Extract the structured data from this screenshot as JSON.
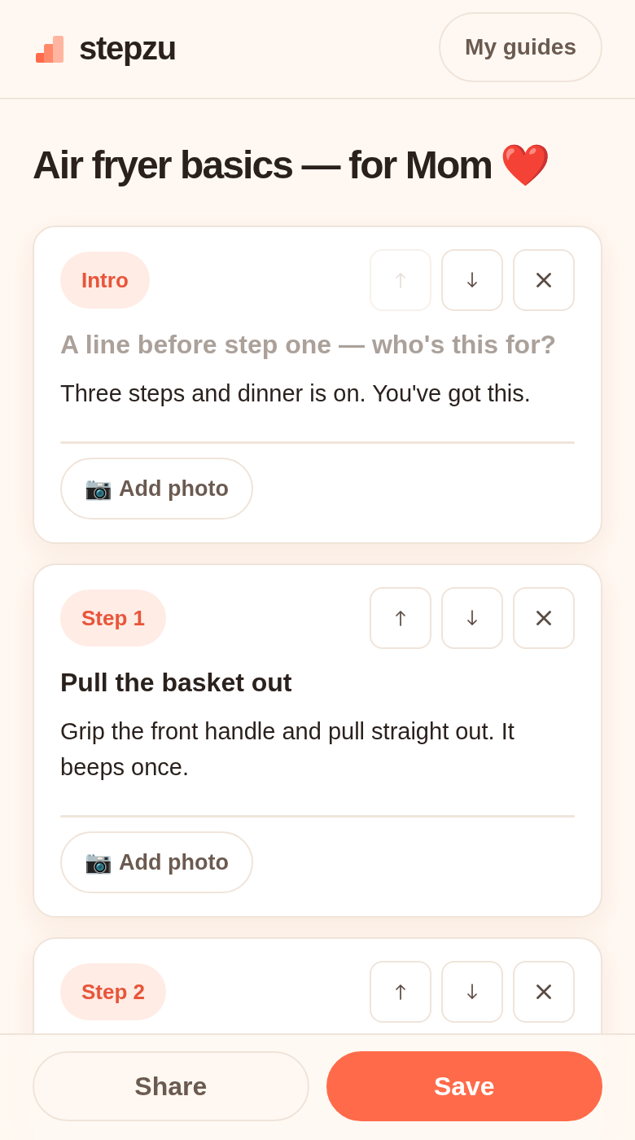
{
  "header": {
    "logo": "stepzu",
    "button": "My guides"
  },
  "guide": {
    "title": "Air fryer basics — for Mom",
    "title_emoji": "❤️"
  },
  "cards": [
    {
      "badge": "Intro",
      "controls": [
        {
          "kind": "up",
          "disabled": true
        },
        {
          "kind": "down",
          "disabled": false
        },
        {
          "kind": "remove",
          "disabled": false
        }
      ],
      "title": {
        "placeholder": "A line before step one — who's this for?"
      },
      "body": "Three steps and dinner is on. You've got this.",
      "photo_button": {
        "icon": "📷",
        "label": "Add photo"
      }
    },
    {
      "badge": "Step 1",
      "controls": [
        {
          "kind": "up",
          "disabled": false
        },
        {
          "kind": "down",
          "disabled": false
        },
        {
          "kind": "remove",
          "disabled": false
        }
      ],
      "title": {
        "value": "Pull the basket out"
      },
      "body": "Grip the front handle and pull straight out. It beeps once.",
      "photo_button": {
        "icon": "📷",
        "label": "Add photo"
      }
    },
    {
      "badge": "Step 2",
      "controls": [
        {
          "kind": "up",
          "disabled": false
        },
        {
          "kind": "down",
          "disabled": false
        },
        {
          "kind": "remove",
          "disabled": false
        }
      ]
    }
  ],
  "footer": {
    "buttons": [
      {
        "kind": "secondary",
        "label": "Share"
      },
      {
        "kind": "primary",
        "label": "Save"
      }
    ]
  }
}
